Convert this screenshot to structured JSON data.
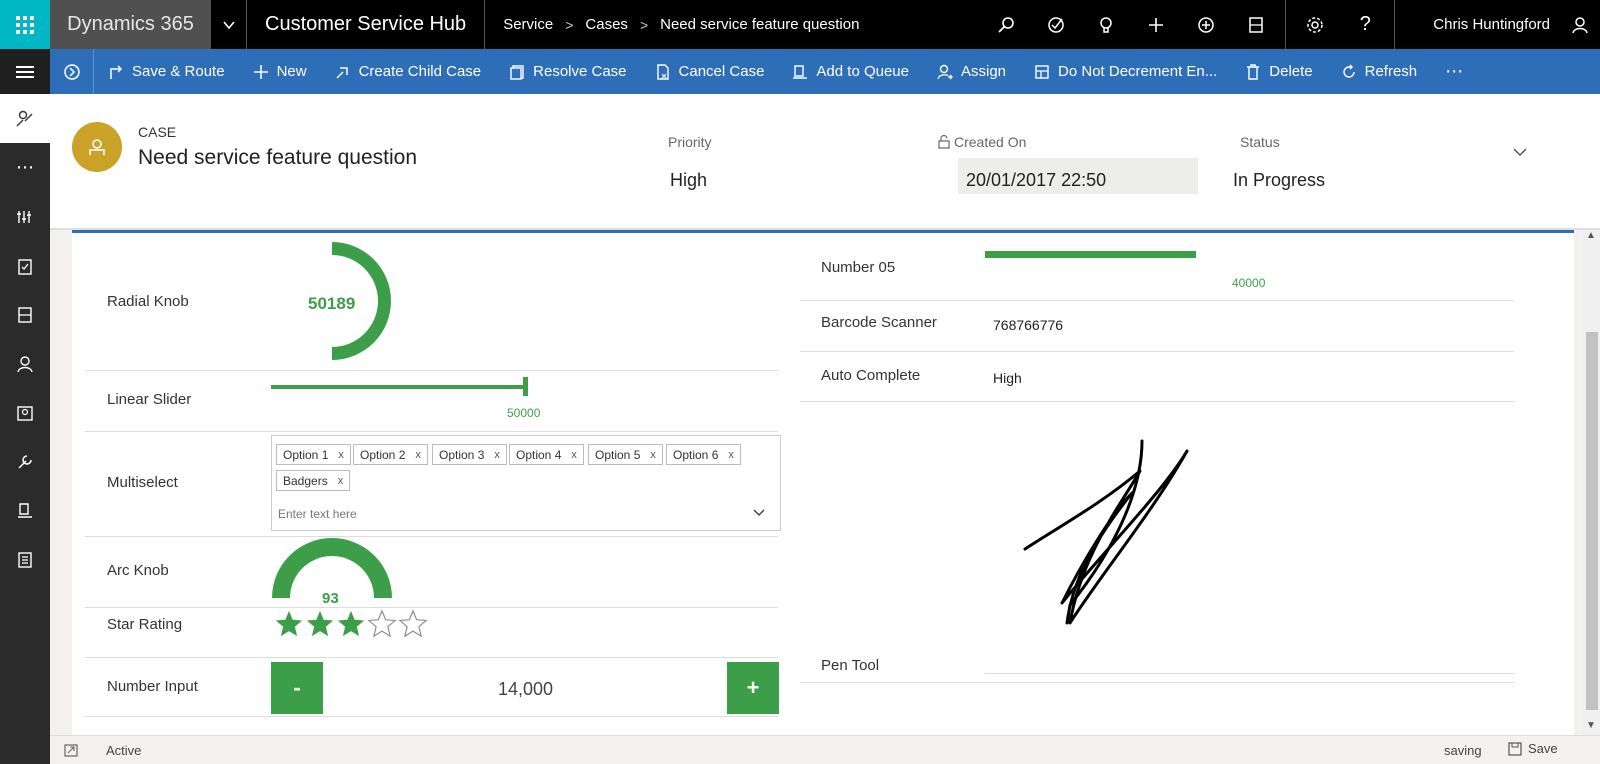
{
  "topbar": {
    "brand": "Dynamics 365",
    "app_name": "Customer Service Hub",
    "breadcrumb": [
      "Service",
      "Cases",
      "Need service feature question"
    ],
    "user": "Chris Huntingford"
  },
  "commands": [
    {
      "label": "Save & Route",
      "icon": "save-route-icon"
    },
    {
      "label": "New",
      "icon": "plus-icon"
    },
    {
      "label": "Create Child Case",
      "icon": "child-case-icon"
    },
    {
      "label": "Resolve Case",
      "icon": "resolve-icon"
    },
    {
      "label": "Cancel Case",
      "icon": "cancel-icon"
    },
    {
      "label": "Add to Queue",
      "icon": "queue-icon"
    },
    {
      "label": "Assign",
      "icon": "assign-icon"
    },
    {
      "label": "Do Not Decrement En...",
      "icon": "decrement-icon"
    },
    {
      "label": "Delete",
      "icon": "trash-icon"
    },
    {
      "label": "Refresh",
      "icon": "refresh-icon"
    }
  ],
  "header": {
    "entity_type": "CASE",
    "title": "Need service feature question",
    "priority_label": "Priority",
    "priority_value": "High",
    "created_label": "Created On",
    "created_value": "20/01/2017 22:50",
    "status_label": "Status",
    "status_value": "In Progress"
  },
  "form": {
    "radial_knob": {
      "label": "Radial Knob",
      "value": "50189"
    },
    "linear_slider": {
      "label": "Linear Slider",
      "value": "50000",
      "fraction": 1.0
    },
    "multiselect": {
      "label": "Multiselect",
      "tags": [
        "Option 1",
        "Option 2",
        "Option 3",
        "Option 4",
        "Option 5",
        "Option 6",
        "Badgers"
      ],
      "placeholder": "Enter text here"
    },
    "arc_knob": {
      "label": "Arc Knob",
      "value": "93"
    },
    "star_rating": {
      "label": "Star Rating",
      "rating": 3,
      "max": 5
    },
    "number_input": {
      "label": "Number Input",
      "value": "14,000",
      "minus": "-",
      "plus": "+"
    },
    "number05": {
      "label": "Number 05",
      "value": "40000"
    },
    "barcode": {
      "label": "Barcode Scanner",
      "value": "768766776"
    },
    "auto_complete": {
      "label": "Auto Complete",
      "value": "High"
    },
    "pen_tool": {
      "label": "Pen Tool"
    }
  },
  "statusbar": {
    "state": "Active",
    "saving": "saving",
    "save": "Save"
  },
  "colors": {
    "accent_green": "#3d9e4a",
    "command_blue": "#2e6eb8",
    "waffle_teal": "#00b7c3",
    "avatar_gold": "#c9a227"
  }
}
